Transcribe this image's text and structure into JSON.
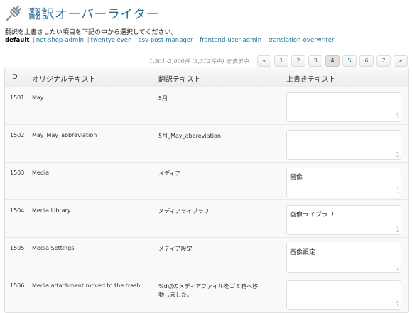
{
  "app": {
    "title": "翻訳オーバーライター"
  },
  "description": "翻訳を上書きしたい項目を下記の中から選択してください。",
  "domains": [
    {
      "label": "default",
      "current": true
    },
    {
      "label": "net-shop-admin",
      "current": false
    },
    {
      "label": "twentyeleven",
      "current": false
    },
    {
      "label": "csv-post-manager",
      "current": false
    },
    {
      "label": "frontend-user-admin",
      "current": false
    },
    {
      "label": "translation-overwriter",
      "current": false
    }
  ],
  "pagination": {
    "info": "1,501–2,000件 (3,312件中) を表示中",
    "first": "«",
    "last": "»",
    "pages": [
      "1",
      "2",
      "3",
      "4",
      "5",
      "6",
      "7"
    ],
    "current": "4"
  },
  "table": {
    "headers": {
      "id": "ID",
      "original": "オリジナルテキスト",
      "translation": "翻訳テキスト",
      "override": "上書きテキスト"
    },
    "rows": [
      {
        "id": "1501",
        "original": "May",
        "translation": "5月",
        "override": ""
      },
      {
        "id": "1502",
        "original": "May_May_abbreviation",
        "translation": "5月_May_abbreviation",
        "override": ""
      },
      {
        "id": "1503",
        "original": "Media",
        "translation": "メディア",
        "override": "画像"
      },
      {
        "id": "1504",
        "original": "Media Library",
        "translation": "メディアライブラリ",
        "override": "画像ライブラリ"
      },
      {
        "id": "1505",
        "original": "Media Settings",
        "translation": "メディア設定",
        "override": "画像設定"
      },
      {
        "id": "1506",
        "original": "Media attachment moved to the trash.",
        "translation": "%d点のメディアファイルをゴミ箱へ移動しました。",
        "override": ""
      }
    ]
  },
  "icons": {
    "plugin": "plug-icon",
    "resize": "resize-grip-icon"
  },
  "colors": {
    "title": "#2a6d96",
    "link": "#21759b"
  }
}
